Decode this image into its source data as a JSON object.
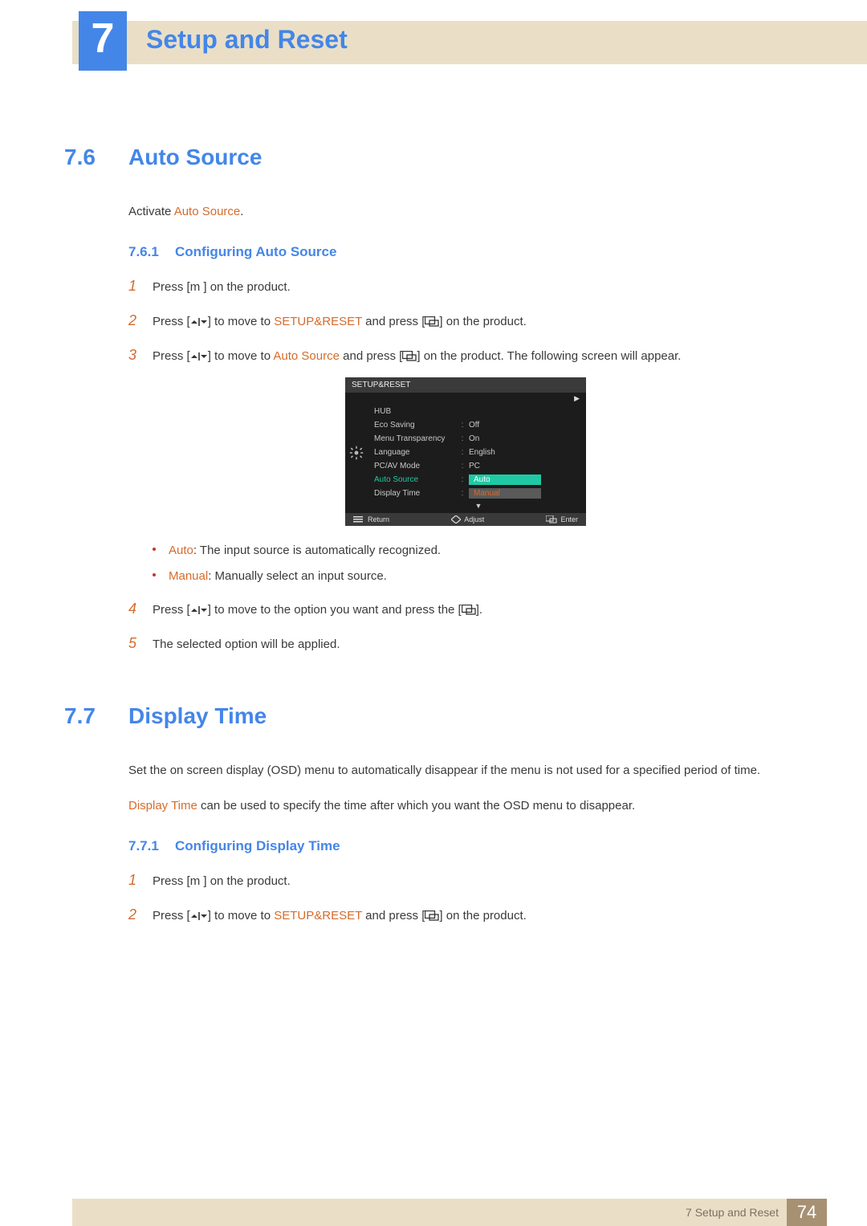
{
  "chapter": {
    "number": "7",
    "title": "Setup and Reset"
  },
  "sections": {
    "s76": {
      "num": "7.6",
      "title": "Auto Source",
      "intro_prefix": "Activate ",
      "intro_hl": "Auto Source",
      "intro_suffix": ".",
      "sub": {
        "num": "7.6.1",
        "title": "Configuring Auto Source"
      },
      "steps": {
        "s1": {
          "n": "1",
          "a": "Press [",
          "m": "m",
          "b": " ] on the product."
        },
        "s2": {
          "n": "2",
          "a": "Press [",
          "b": "] to move to ",
          "hl": "SETUP&RESET",
          "c": " and press [",
          "d": "] on the product."
        },
        "s3": {
          "n": "3",
          "a": "Press [",
          "b": "] to move to ",
          "hl": "Auto Source",
          "c": " and press [",
          "d": "] on the product. The following screen will appear."
        },
        "s4": {
          "n": "4",
          "a": "Press [",
          "b": "] to move to the option you want and press the [",
          "c": "]."
        },
        "s5": {
          "n": "5",
          "text": "The selected option will be applied."
        }
      },
      "bullets": {
        "b1": {
          "hl": "Auto",
          "text": ": The input source is automatically recognized."
        },
        "b2": {
          "hl": "Manual",
          "text": ": Manually select an input source."
        }
      }
    },
    "s77": {
      "num": "7.7",
      "title": "Display Time",
      "p1": "Set the on screen display (OSD) menu to automatically disappear if the menu is not used for a specified period of time.",
      "p2_hl": "Display Time",
      "p2_rest": " can be used to specify the time after which you want the OSD menu to disappear.",
      "sub": {
        "num": "7.7.1",
        "title": "Configuring Display Time"
      },
      "steps": {
        "s1": {
          "n": "1",
          "a": "Press [",
          "m": "m",
          "b": " ] on the product."
        },
        "s2": {
          "n": "2",
          "a": "Press [",
          "b": "] to move to ",
          "hl": "SETUP&RESET",
          "c": " and press [",
          "d": "] on the product."
        }
      }
    }
  },
  "osd": {
    "title": "SETUP&RESET",
    "rows": {
      "hub": {
        "label": "HUB",
        "value": ""
      },
      "eco": {
        "label": "Eco Saving",
        "value": "Off"
      },
      "trans": {
        "label": "Menu Transparency",
        "value": "On"
      },
      "lang": {
        "label": "Language",
        "value": "English"
      },
      "pcav": {
        "label": "PC/AV Mode",
        "value": "PC"
      },
      "auto": {
        "label": "Auto Source",
        "sel": "Auto",
        "opt": "Manual"
      },
      "disp": {
        "label": "Display Time",
        "value": ""
      }
    },
    "footer": {
      "return": "Return",
      "adjust": "Adjust",
      "enter": "Enter"
    }
  },
  "footer": {
    "label": "7 Setup and Reset",
    "page": "74"
  }
}
